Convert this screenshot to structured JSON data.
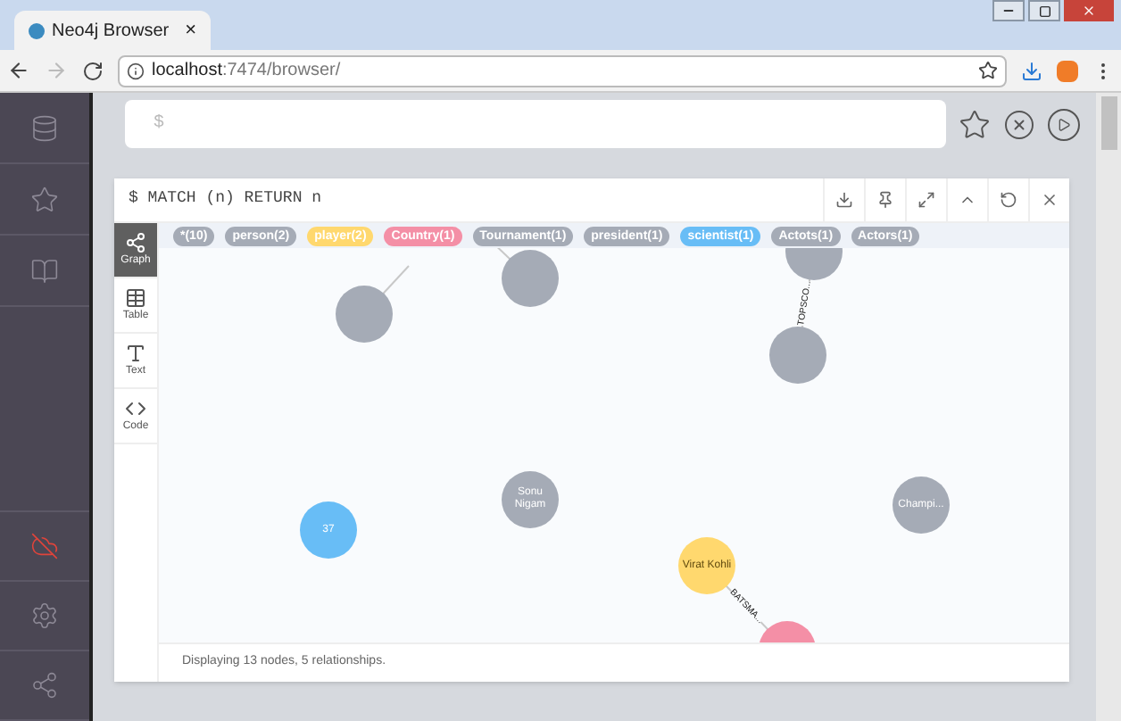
{
  "browser": {
    "tab_title": "Neo4j Browser",
    "tab_close": "×",
    "url_host": "localhost",
    "url_path": ":7474/browser/"
  },
  "editor": {
    "placeholder": "$"
  },
  "result": {
    "query": "$ MATCH (n) RETURN n",
    "view_tabs": [
      {
        "label": "Graph",
        "kind": "graph",
        "selected": true
      },
      {
        "label": "Table",
        "kind": "table",
        "selected": false
      },
      {
        "label": "Text",
        "kind": "text",
        "selected": false
      },
      {
        "label": "Code",
        "kind": "code",
        "selected": false
      }
    ],
    "labels": [
      {
        "text": "*(10)",
        "color": "#a5abb6"
      },
      {
        "text": "person(2)",
        "color": "#a5abb6"
      },
      {
        "text": "player(2)",
        "color": "#ffd86e"
      },
      {
        "text": "Country(1)",
        "color": "#f48fa6"
      },
      {
        "text": "Tournament(1)",
        "color": "#a5abb6"
      },
      {
        "text": "president(1)",
        "color": "#a5abb6"
      },
      {
        "text": "scientist(1)",
        "color": "#68bdf6"
      },
      {
        "text": "Actots(1)",
        "color": "#a5abb6"
      },
      {
        "text": "Actors(1)",
        "color": "#a5abb6"
      }
    ],
    "nodes": [
      {
        "color": "#a5abb6"
      },
      {
        "color": "#a5abb6"
      },
      {
        "color": "#a5abb6"
      },
      {
        "color": "#a5abb6"
      },
      {
        "label": "37",
        "color": "#68bdf6"
      },
      {
        "label": "Sonu Nigam",
        "color": "#a5abb6"
      },
      {
        "label": "Champi...",
        "color": "#a5abb6"
      },
      {
        "label": "Virat Kohli",
        "color": "#ffd86e"
      },
      {
        "color": "#f48fa6"
      }
    ],
    "relationships": [
      {
        "label": "TOPSCO..."
      },
      {
        "label": "BATSMA..."
      }
    ],
    "status": "Displaying 13 nodes, 5 relationships."
  }
}
